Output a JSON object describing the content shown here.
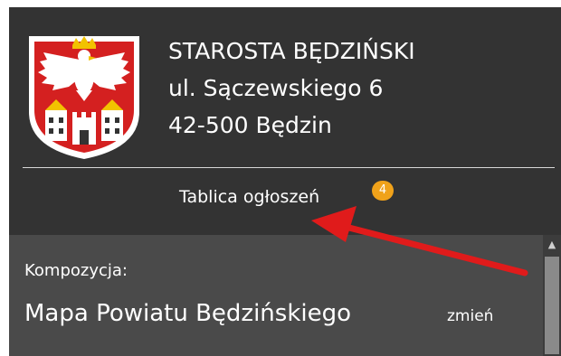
{
  "office": {
    "name": "STAROSTA BĘDZIŃSKI",
    "street": "ul. Sączewskiego 6",
    "city": "42-500 Będzin"
  },
  "notice_board": {
    "label": "Tablica ogłoszeń",
    "badge_count": "4"
  },
  "composition": {
    "label": "Kompozycja:",
    "name": "Mapa Powiatu Będzińskiego",
    "change_link": "zmień"
  },
  "icons": {
    "crest": "coat-of-arms-icon",
    "scroll_up": "chevron-up-icon",
    "annotation": "red-arrow"
  },
  "colors": {
    "panel_bg": "#333333",
    "composition_bg": "#4a4a4a",
    "badge": "#f0a21a",
    "arrow": "#e01b1b",
    "crest_red": "#d42020"
  }
}
